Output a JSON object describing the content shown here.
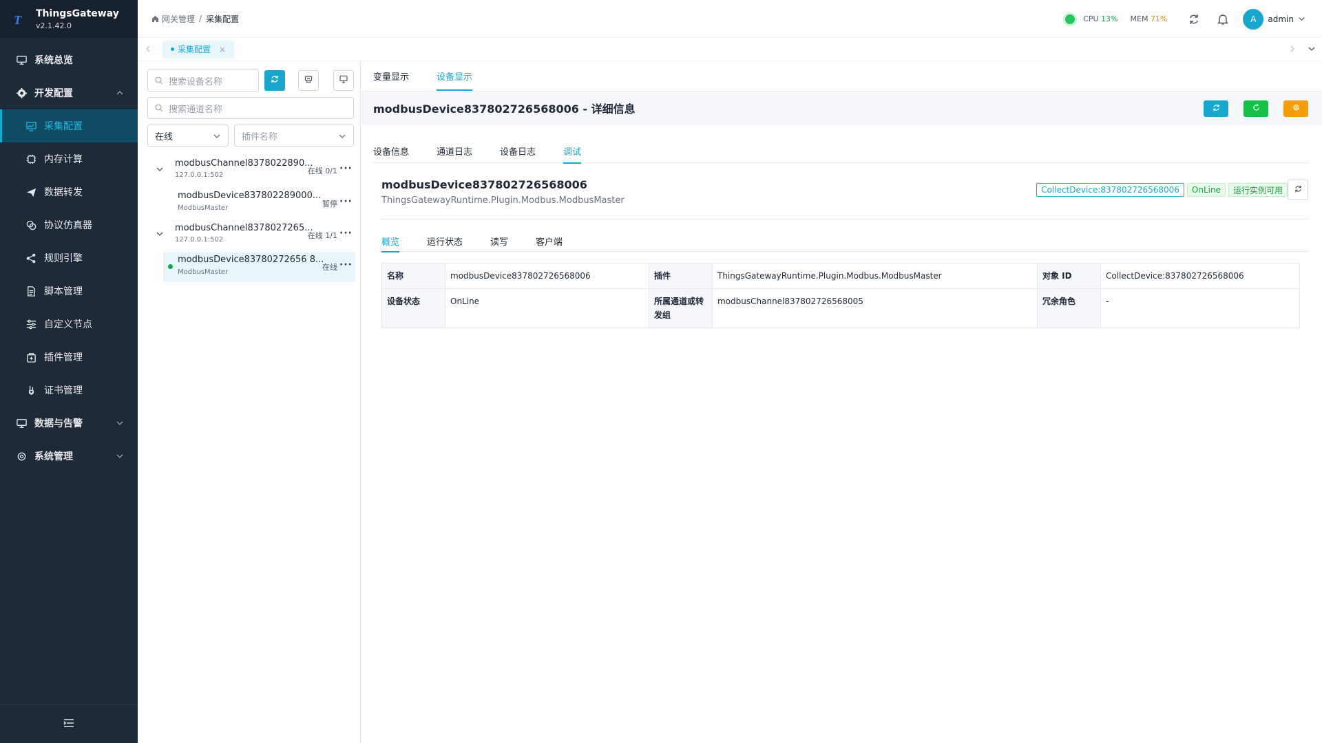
{
  "app": {
    "name": "ThingsGateway",
    "version": "v2.1.42.0",
    "logo": "T"
  },
  "sidebar": {
    "items": [
      {
        "label": "系统总览",
        "icon": "monitor-icon",
        "type": "top"
      },
      {
        "label": "开发配置",
        "icon": "gear-icon",
        "type": "group-open"
      },
      {
        "label": "采集配置",
        "icon": "chart-monitor-icon",
        "type": "sub-active"
      },
      {
        "label": "内存计算",
        "icon": "chip-icon",
        "type": "sub"
      },
      {
        "label": "数据转发",
        "icon": "send-icon",
        "type": "sub"
      },
      {
        "label": "协议仿真器",
        "icon": "layers-icon",
        "type": "sub"
      },
      {
        "label": "规则引擎",
        "icon": "share-icon",
        "type": "sub"
      },
      {
        "label": "脚本管理",
        "icon": "document-icon",
        "type": "sub"
      },
      {
        "label": "自定义节点",
        "icon": "sliders-icon",
        "type": "sub"
      },
      {
        "label": "插件管理",
        "icon": "package-icon",
        "type": "sub"
      },
      {
        "label": "证书管理",
        "icon": "certificate-icon",
        "type": "sub"
      },
      {
        "label": "数据与告警",
        "icon": "monitor-icon",
        "type": "group-closed"
      },
      {
        "label": "系统管理",
        "icon": "gear-outline-icon",
        "type": "group-closed"
      }
    ]
  },
  "header": {
    "breadcrumb": [
      "网关管理",
      "采集配置"
    ],
    "cpu_label": "CPU",
    "cpu_value": "13%",
    "mem_label": "MEM",
    "mem_value": "71%",
    "user_initial": "A",
    "user_name": "admin"
  },
  "tabbar": {
    "active_tab": "采集配置",
    "close": "×"
  },
  "left": {
    "search_device_placeholder": "搜索设备名称",
    "search_channel_placeholder": "搜索通道名称",
    "status_filter": "在线",
    "plugin_placeholder": "插件名称",
    "tree": [
      {
        "kind": "channel",
        "name": "modbusChannel8378022890...",
        "addr": "127.0.0.1:502",
        "status": "在线 0/1"
      },
      {
        "kind": "device",
        "name": "modbusDevice837802289000...",
        "plugin": "ModbusMaster",
        "status": "暂停",
        "selected": false
      },
      {
        "kind": "channel",
        "name": "modbusChannel8378027265...",
        "addr": "127.0.0.1:502",
        "status": "在线 1/1"
      },
      {
        "kind": "device",
        "name": "modbusDevice83780272656 8...",
        "plugin": "ModbusMaster",
        "status": "在线",
        "selected": true
      }
    ]
  },
  "right": {
    "top_tabs": [
      "变量显示",
      "设备显示"
    ],
    "detail_title": "modbusDevice837802726568006 - 详细信息",
    "sub_tabs": [
      "设备信息",
      "通道日志",
      "设备日志",
      "调试"
    ],
    "device": {
      "name": "modbusDevice837802726568006",
      "plugin": "ThingsGatewayRuntime.Plugin.Modbus.ModbusMaster",
      "tag_id": "CollectDevice:837802726568006",
      "tag_status": "OnLine",
      "tag_runtime": "运行实例可用"
    },
    "inner_tabs": [
      "概览",
      "运行状态",
      "读写",
      "客户端"
    ],
    "info": {
      "name_label": "名称",
      "name_value": "modbusDevice837802726568006",
      "plugin_label": "插件",
      "plugin_value": "ThingsGatewayRuntime.Plugin.Modbus.ModbusMaster",
      "objid_label": "对象 ID",
      "objid_value": "CollectDevice:837802726568006",
      "state_label": "设备状态",
      "state_value": "OnLine",
      "channel_label": "所属通道或转发组",
      "channel_value": "modbusChannel837802726568005",
      "redundant_label": "冗余角色",
      "redundant_value": "-"
    }
  },
  "colors": {
    "primary": "#19a7ce",
    "success": "#16c047",
    "warning": "#f59e0b",
    "sidebar_bg": "#1e2a38"
  }
}
